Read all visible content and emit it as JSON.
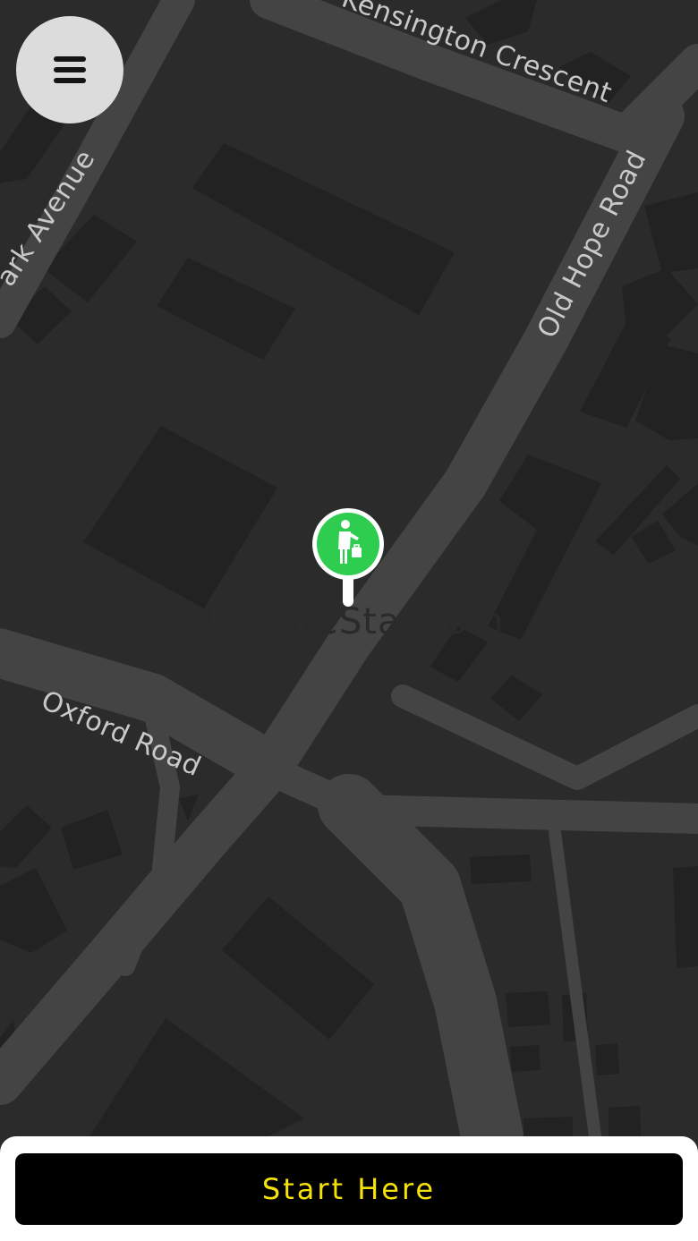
{
  "map": {
    "streets": {
      "kensington": "Kensington Crescent",
      "park": "ark Avenue",
      "old_hope": "Old Hope Road",
      "oxford": "Oxford Road"
    },
    "watermark": "UpdateStar.com",
    "colors": {
      "background": "#2b2b2b",
      "building": "#222222",
      "road": "#444444",
      "label": "#c9c9c9"
    }
  },
  "menu": {
    "icon": "hamburger-menu-icon"
  },
  "pin": {
    "icon": "hitchhiker-person-icon",
    "color": "#2ecc4f"
  },
  "action": {
    "start_label": "Start Here",
    "text_color": "#f5e20a"
  }
}
